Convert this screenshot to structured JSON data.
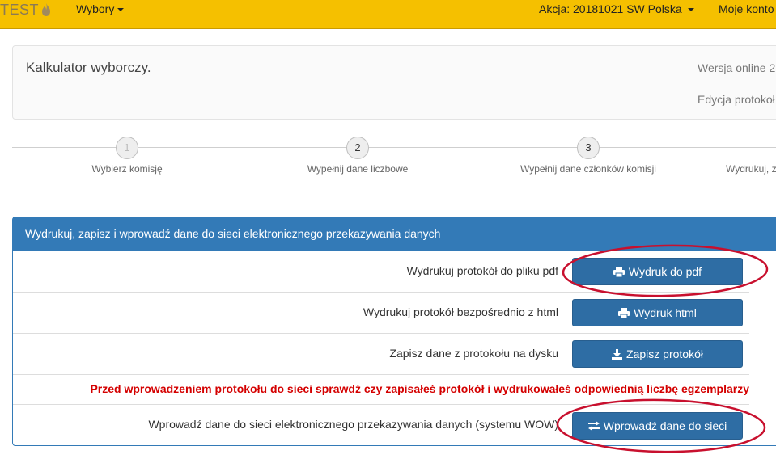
{
  "nav": {
    "brand": "TEST",
    "menu_elections": "Wybory",
    "action": "Akcja: 20181021 SW Polska",
    "account": "Moje konto"
  },
  "header": {
    "title": "Kalkulator wyborczy.",
    "version": "Wersja online 2",
    "edition": "Edycja protokoł"
  },
  "steps": [
    {
      "number": "1",
      "label": "Wybierz komisję"
    },
    {
      "number": "2",
      "label": "Wypełnij dane liczbowe"
    },
    {
      "number": "3",
      "label": "Wypełnij dane członków komisji"
    },
    {
      "label": "Wydrukuj, z"
    }
  ],
  "panel": {
    "heading": "Wydrukuj, zapisz i wprowadź dane do sieci elektronicznego przekazywania danych",
    "rows": [
      {
        "label": "Wydrukuj protokół do pliku pdf",
        "button": "Wydruk do pdf"
      },
      {
        "label": "Wydrukuj protokół bezpośrednio z html",
        "button": "Wydruk html"
      },
      {
        "label": "Zapisz dane z protokołu na dysku",
        "button": "Zapisz protokół"
      }
    ],
    "warning": "Przed wprowadzeniem protokołu do sieci sprawdź czy zapisałeś protokół i wydrukowałeś odpowiednią liczbę egzemplarzy",
    "network_row": {
      "label": "Wprowadź dane do sieci elektronicznego przekazywania danych (systemu WOW)",
      "button": "Wprowadź dane do sieci"
    }
  },
  "colors": {
    "navbar": "#f5c000",
    "primary": "#337ab7",
    "button": "#2e6da4",
    "warning": "#d40000",
    "annotation": "#c8102e"
  }
}
